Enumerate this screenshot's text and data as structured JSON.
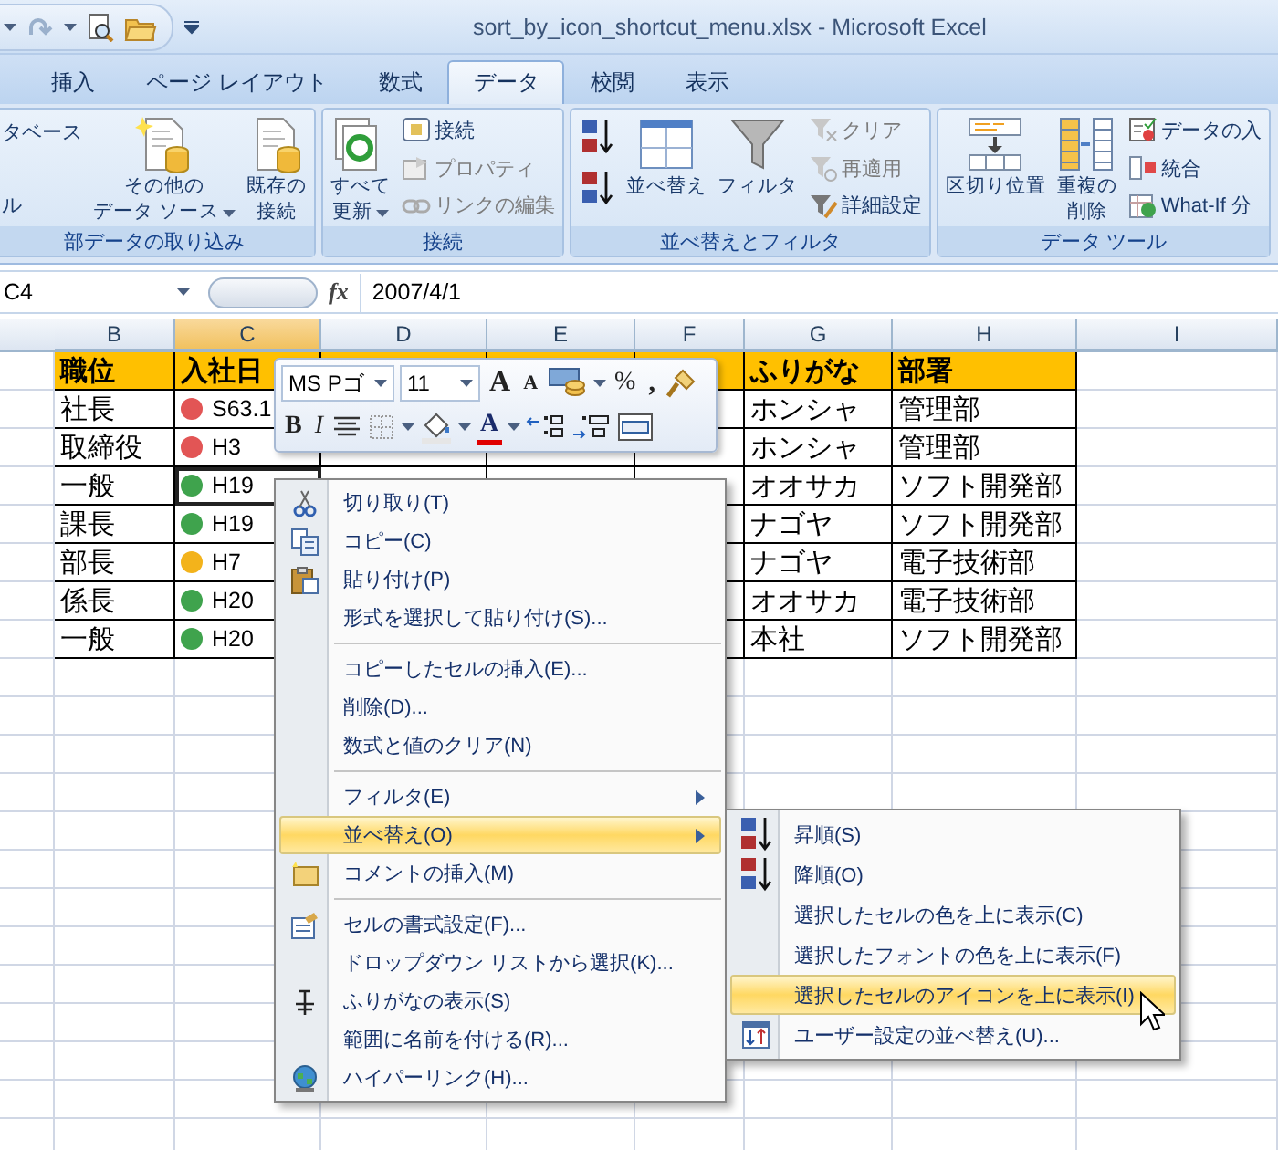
{
  "window": {
    "title": "sort_by_icon_shortcut_menu.xlsx - Microsoft Excel"
  },
  "tabs": [
    {
      "label": "挿入",
      "selected": false
    },
    {
      "label": "ページ レイアウト",
      "selected": false
    },
    {
      "label": "数式",
      "selected": false
    },
    {
      "label": "データ",
      "selected": true
    },
    {
      "label": "校閲",
      "selected": false
    },
    {
      "label": "表示",
      "selected": false
    }
  ],
  "ribbon": {
    "groups": [
      {
        "label": "部データの取り込み",
        "columns": [
          [
            {
              "kind": "small",
              "label": "タベース",
              "disabled": false,
              "dropdown": false
            },
            {
              "kind": "small",
              "label": "ル",
              "disabled": false,
              "dropdown": false
            }
          ],
          [
            {
              "kind": "large",
              "lines": [
                "その他の",
                "データ ソース"
              ],
              "disabled": false,
              "dropdown": true
            }
          ],
          [
            {
              "kind": "large",
              "lines": [
                "既存の",
                "接続"
              ],
              "disabled": false,
              "dropdown": false
            }
          ]
        ]
      },
      {
        "label": "接続",
        "columns": [
          [
            {
              "kind": "large",
              "lines": [
                "すべて",
                "更新"
              ],
              "disabled": false,
              "dropdown": true
            }
          ],
          [
            {
              "kind": "small",
              "label": "接続",
              "disabled": false,
              "dropdown": false
            },
            {
              "kind": "small",
              "label": "プロパティ",
              "disabled": true,
              "dropdown": false
            },
            {
              "kind": "small",
              "label": "リンクの編集",
              "disabled": true,
              "dropdown": false
            }
          ]
        ]
      },
      {
        "label": "並べ替えとフィルタ",
        "columns": [
          [
            {
              "kind": "icon",
              "disabled": false,
              "dropdown": false
            },
            {
              "kind": "icon",
              "disabled": false,
              "dropdown": false
            }
          ],
          [
            {
              "kind": "large",
              "lines": [
                "並べ替え"
              ],
              "disabled": false,
              "dropdown": false
            }
          ],
          [
            {
              "kind": "large",
              "lines": [
                "フィルタ"
              ],
              "disabled": false,
              "dropdown": false
            }
          ],
          [
            {
              "kind": "small",
              "label": "クリア",
              "disabled": true,
              "dropdown": false
            },
            {
              "kind": "small",
              "label": "再適用",
              "disabled": true,
              "dropdown": false
            },
            {
              "kind": "small",
              "label": "詳細設定",
              "disabled": false,
              "dropdown": false
            }
          ]
        ]
      },
      {
        "label": "データ ツール",
        "columns": [
          [
            {
              "kind": "large",
              "lines": [
                "区切り位置"
              ],
              "disabled": false,
              "dropdown": false
            }
          ],
          [
            {
              "kind": "large",
              "lines": [
                "重複の",
                "削除"
              ],
              "disabled": false,
              "dropdown": false
            }
          ],
          [
            {
              "kind": "small",
              "label": "データの入",
              "disabled": false,
              "dropdown": false
            },
            {
              "kind": "small",
              "label": "統合",
              "disabled": false,
              "dropdown": false
            },
            {
              "kind": "small",
              "label": "What-If 分",
              "disabled": false,
              "dropdown": false
            }
          ]
        ]
      }
    ]
  },
  "formula_bar": {
    "name_box": "C4",
    "fx": "fx",
    "value": "2007/4/1"
  },
  "sheet": {
    "columns": [
      {
        "label": "B",
        "selected": false
      },
      {
        "label": "C",
        "selected": true
      },
      {
        "label": "D",
        "selected": false
      },
      {
        "label": "E",
        "selected": false
      },
      {
        "label": "F",
        "selected": false
      },
      {
        "label": "G",
        "selected": false
      },
      {
        "label": "H",
        "selected": false
      },
      {
        "label": "I",
        "selected": false
      }
    ],
    "rows": [
      {
        "kind": "header",
        "b": "職位",
        "c": "入社日",
        "g": "ふりがな",
        "h": "部署"
      },
      {
        "kind": "data",
        "b": "社長",
        "c": "S63.1",
        "color": "#e25555",
        "g": "ホンシャ",
        "h": "管理部",
        "selected": false
      },
      {
        "kind": "data",
        "b": "取締役",
        "c": "H3",
        "color": "#e25555",
        "g": "ホンシャ",
        "h": "管理部",
        "selected": false
      },
      {
        "kind": "data",
        "b": "一般",
        "c": "H19",
        "color": "#3fa34d",
        "g": "オオサカ",
        "h": "ソフト開発部",
        "selected": true
      },
      {
        "kind": "data",
        "b": "課長",
        "c": "H19",
        "color": "#3fa34d",
        "g": "ナゴヤ",
        "h": "ソフト開発部",
        "selected": false
      },
      {
        "kind": "data",
        "b": "部長",
        "c": "H7",
        "color": "#f3b31b",
        "g": "ナゴヤ",
        "h": "電子技術部",
        "selected": false
      },
      {
        "kind": "data",
        "b": "係長",
        "c": "H20",
        "color": "#3fa34d",
        "g": "オオサカ",
        "h": "電子技術部",
        "selected": false
      },
      {
        "kind": "data",
        "b": "一般",
        "c": "H20",
        "color": "#3fa34d",
        "g": "本社",
        "h": "ソフト開発部",
        "selected": false
      }
    ]
  },
  "mini_toolbar": {
    "font": "MS Pゴ",
    "size": "11",
    "grow_font": "A",
    "shrink_font": "A",
    "percent": "%",
    "comma": ",",
    "bold": "B",
    "italic": "I",
    "font_color": "A"
  },
  "context_menu": {
    "items": [
      {
        "kind": "item",
        "label": "切り取り(T)",
        "submenu": false,
        "selected": false
      },
      {
        "kind": "item",
        "label": "コピー(C)",
        "submenu": false,
        "selected": false
      },
      {
        "kind": "item",
        "label": "貼り付け(P)",
        "submenu": false,
        "selected": false
      },
      {
        "kind": "item",
        "label": "形式を選択して貼り付け(S)...",
        "submenu": false,
        "selected": false
      },
      {
        "kind": "separator"
      },
      {
        "kind": "item",
        "label": "コピーしたセルの挿入(E)...",
        "submenu": false,
        "selected": false
      },
      {
        "kind": "item",
        "label": "削除(D)...",
        "submenu": false,
        "selected": false
      },
      {
        "kind": "item",
        "label": "数式と値のクリア(N)",
        "submenu": false,
        "selected": false
      },
      {
        "kind": "separator"
      },
      {
        "kind": "item",
        "label": "フィルタ(E)",
        "submenu": true,
        "selected": false
      },
      {
        "kind": "item",
        "label": "並べ替え(O)",
        "submenu": true,
        "selected": true
      },
      {
        "kind": "item",
        "label": "コメントの挿入(M)",
        "submenu": false,
        "selected": false
      },
      {
        "kind": "separator"
      },
      {
        "kind": "item",
        "label": "セルの書式設定(F)...",
        "submenu": false,
        "selected": false
      },
      {
        "kind": "item",
        "label": "ドロップダウン リストから選択(K)...",
        "submenu": false,
        "selected": false
      },
      {
        "kind": "item",
        "label": "ふりがなの表示(S)",
        "submenu": false,
        "selected": false
      },
      {
        "kind": "item",
        "label": "範囲に名前を付ける(R)...",
        "submenu": false,
        "selected": false
      },
      {
        "kind": "item",
        "label": "ハイパーリンク(H)...",
        "submenu": false,
        "selected": false
      }
    ]
  },
  "submenu": {
    "items": [
      {
        "label": "昇順(S)",
        "selected": false
      },
      {
        "label": "降順(O)",
        "selected": false
      },
      {
        "label": "選択したセルの色を上に表示(C)",
        "selected": false
      },
      {
        "label": "選択したフォントの色を上に表示(F)",
        "selected": false
      },
      {
        "label": "選択したセルのアイコンを上に表示(I)",
        "selected": true
      },
      {
        "label": "ユーザー設定の並べ替え(U)...",
        "selected": false
      }
    ]
  }
}
